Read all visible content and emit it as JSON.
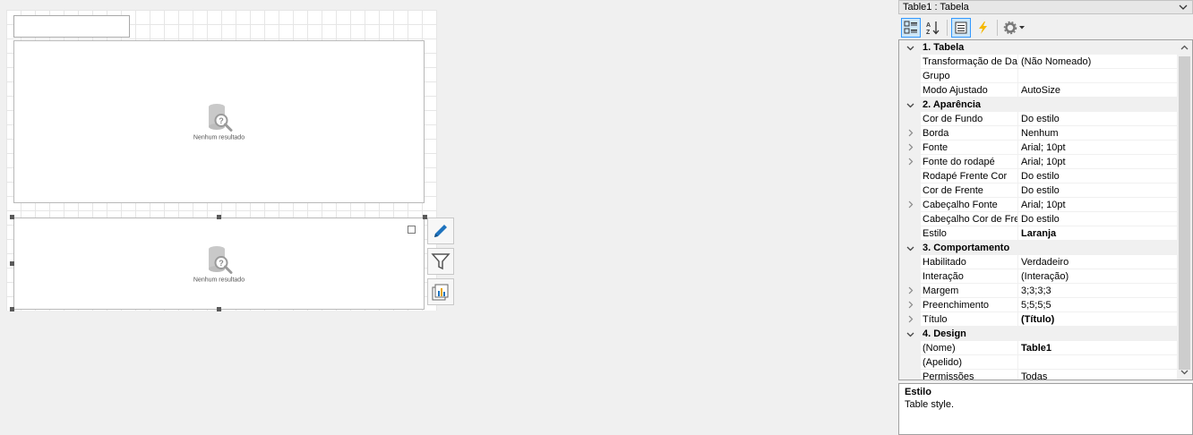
{
  "canvas": {
    "empty_text_1": "Nenhum resultado",
    "empty_text_2": "Nenhum resultado"
  },
  "side_tools": [
    {
      "icon": "pencil-icon"
    },
    {
      "icon": "filter-icon"
    },
    {
      "icon": "chart-icon"
    }
  ],
  "properties": {
    "object_selector": "Table1 : Tabela",
    "toolbar": [
      "categorized-icon",
      "alphabetical-icon",
      "property-pages-icon",
      "events-icon",
      "settings-icon"
    ],
    "categories": [
      {
        "title": "1. Tabela",
        "rows": [
          {
            "name": "Transformação de Dados",
            "value": "(Não Nomeado)",
            "expandable": false,
            "bold": false
          },
          {
            "name": "Grupo",
            "value": "",
            "expandable": false,
            "bold": false
          },
          {
            "name": "Modo Ajustado",
            "value": "AutoSize",
            "expandable": false,
            "bold": false
          }
        ]
      },
      {
        "title": "2. Aparência",
        "rows": [
          {
            "name": "Cor de Fundo",
            "value": "Do estilo",
            "expandable": false,
            "bold": false
          },
          {
            "name": "Borda",
            "value": "Nenhum",
            "expandable": true,
            "bold": false
          },
          {
            "name": "Fonte",
            "value": "Arial; 10pt",
            "expandable": true,
            "bold": false
          },
          {
            "name": "Fonte do rodapé",
            "value": "Arial; 10pt",
            "expandable": true,
            "bold": false
          },
          {
            "name": "Rodapé Frente Cor",
            "value": "Do estilo",
            "expandable": false,
            "bold": false
          },
          {
            "name": "Cor de Frente",
            "value": "Do estilo",
            "expandable": false,
            "bold": false
          },
          {
            "name": "Cabeçalho Fonte",
            "value": "Arial; 10pt",
            "expandable": true,
            "bold": false
          },
          {
            "name": "Cabeçalho Cor de Frente",
            "value": "Do estilo",
            "expandable": false,
            "bold": false
          },
          {
            "name": "Estilo",
            "value": "Laranja",
            "expandable": false,
            "bold": true
          }
        ]
      },
      {
        "title": "3. Comportamento",
        "rows": [
          {
            "name": "Habilitado",
            "value": "Verdadeiro",
            "expandable": false,
            "bold": false
          },
          {
            "name": "Interação",
            "value": "(Interação)",
            "expandable": false,
            "bold": false
          },
          {
            "name": "Margem",
            "value": "3;3;3;3",
            "expandable": true,
            "bold": false
          },
          {
            "name": "Preenchimento",
            "value": "5;5;5;5",
            "expandable": true,
            "bold": false
          },
          {
            "name": "Título",
            "value": "(Título)",
            "expandable": true,
            "bold": true
          }
        ]
      },
      {
        "title": "4. Design",
        "rows": [
          {
            "name": "(Nome)",
            "value": "Table1",
            "expandable": false,
            "bold": true
          },
          {
            "name": "(Apelido)",
            "value": "",
            "expandable": false,
            "bold": false
          },
          {
            "name": "Permissões",
            "value": "Todas",
            "expandable": false,
            "bold": false
          }
        ]
      }
    ],
    "description": {
      "title": "Estilo",
      "text": "Table style."
    }
  },
  "colors": {
    "accent": "#3399ff",
    "pencil": "#1e73be",
    "events": "#f5b800"
  }
}
